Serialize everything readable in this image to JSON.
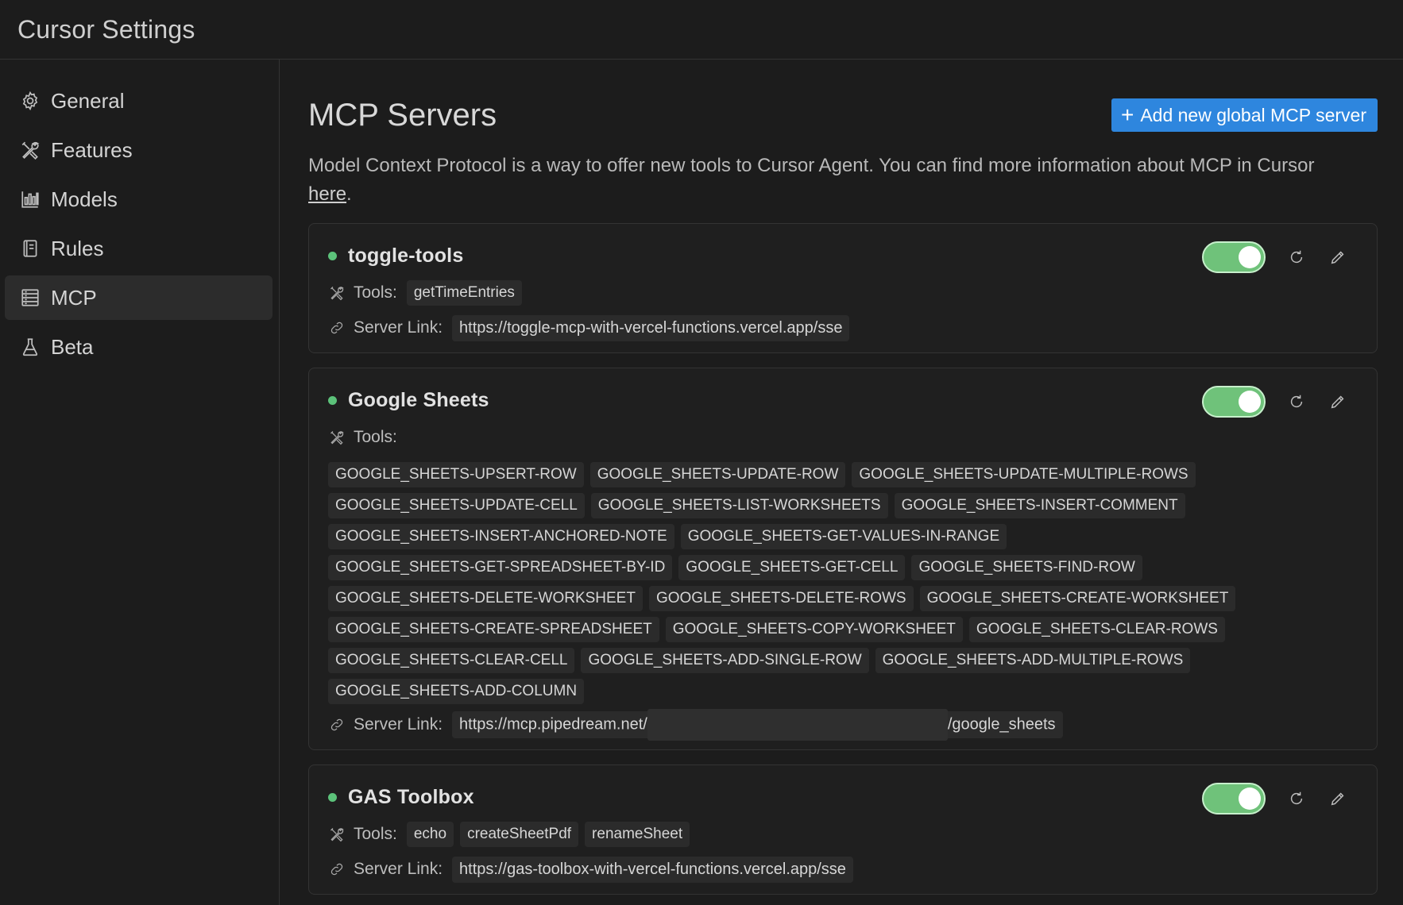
{
  "app": {
    "title": "Cursor Settings"
  },
  "sidebar": {
    "items": [
      {
        "label": "General",
        "icon": "gear-icon",
        "active": false
      },
      {
        "label": "Features",
        "icon": "tools-icon",
        "active": false
      },
      {
        "label": "Models",
        "icon": "bar-chart-icon",
        "active": false
      },
      {
        "label": "Rules",
        "icon": "book-icon",
        "active": false
      },
      {
        "label": "MCP",
        "icon": "server-icon",
        "active": true
      },
      {
        "label": "Beta",
        "icon": "flask-icon",
        "active": false
      }
    ]
  },
  "main": {
    "title": "MCP Servers",
    "add_button": "Add new global MCP server",
    "description": "Model Context Protocol is a way to offer new tools to Cursor Agent. You can find more information about MCP in Cursor ",
    "description_link": "here",
    "description_end": "."
  },
  "labels": {
    "tools": "Tools:",
    "server_link": "Server Link:"
  },
  "servers": [
    {
      "name": "toggle-tools",
      "status_color": "#5cc27a",
      "enabled": true,
      "tools": [
        "getTimeEntries"
      ],
      "link": "https://toggle-mcp-with-vercel-functions.vercel.app/sse"
    },
    {
      "name": "Google Sheets",
      "status_color": "#5cc27a",
      "enabled": true,
      "tools": [
        "GOOGLE_SHEETS-UPSERT-ROW",
        "GOOGLE_SHEETS-UPDATE-ROW",
        "GOOGLE_SHEETS-UPDATE-MULTIPLE-ROWS",
        "GOOGLE_SHEETS-UPDATE-CELL",
        "GOOGLE_SHEETS-LIST-WORKSHEETS",
        "GOOGLE_SHEETS-INSERT-COMMENT",
        "GOOGLE_SHEETS-INSERT-ANCHORED-NOTE",
        "GOOGLE_SHEETS-GET-VALUES-IN-RANGE",
        "GOOGLE_SHEETS-GET-SPREADSHEET-BY-ID",
        "GOOGLE_SHEETS-GET-CELL",
        "GOOGLE_SHEETS-FIND-ROW",
        "GOOGLE_SHEETS-DELETE-WORKSHEET",
        "GOOGLE_SHEETS-DELETE-ROWS",
        "GOOGLE_SHEETS-CREATE-WORKSHEET",
        "GOOGLE_SHEETS-CREATE-SPREADSHEET",
        "GOOGLE_SHEETS-COPY-WORKSHEET",
        "GOOGLE_SHEETS-CLEAR-ROWS",
        "GOOGLE_SHEETS-CLEAR-CELL",
        "GOOGLE_SHEETS-ADD-SINGLE-ROW",
        "GOOGLE_SHEETS-ADD-MULTIPLE-ROWS",
        "GOOGLE_SHEETS-ADD-COLUMN"
      ],
      "link_prefix": "https://mcp.pipedream.net/",
      "link_suffix": "/google_sheets"
    },
    {
      "name": "GAS Toolbox",
      "status_color": "#5cc27a",
      "enabled": true,
      "tools": [
        "echo",
        "createSheetPdf",
        "renameSheet"
      ],
      "link": "https://gas-toolbox-with-vercel-functions.vercel.app/sse"
    }
  ],
  "colors": {
    "accent": "#2e86de",
    "toggle_on": "#6fc27a",
    "background": "#1c1c1c"
  }
}
